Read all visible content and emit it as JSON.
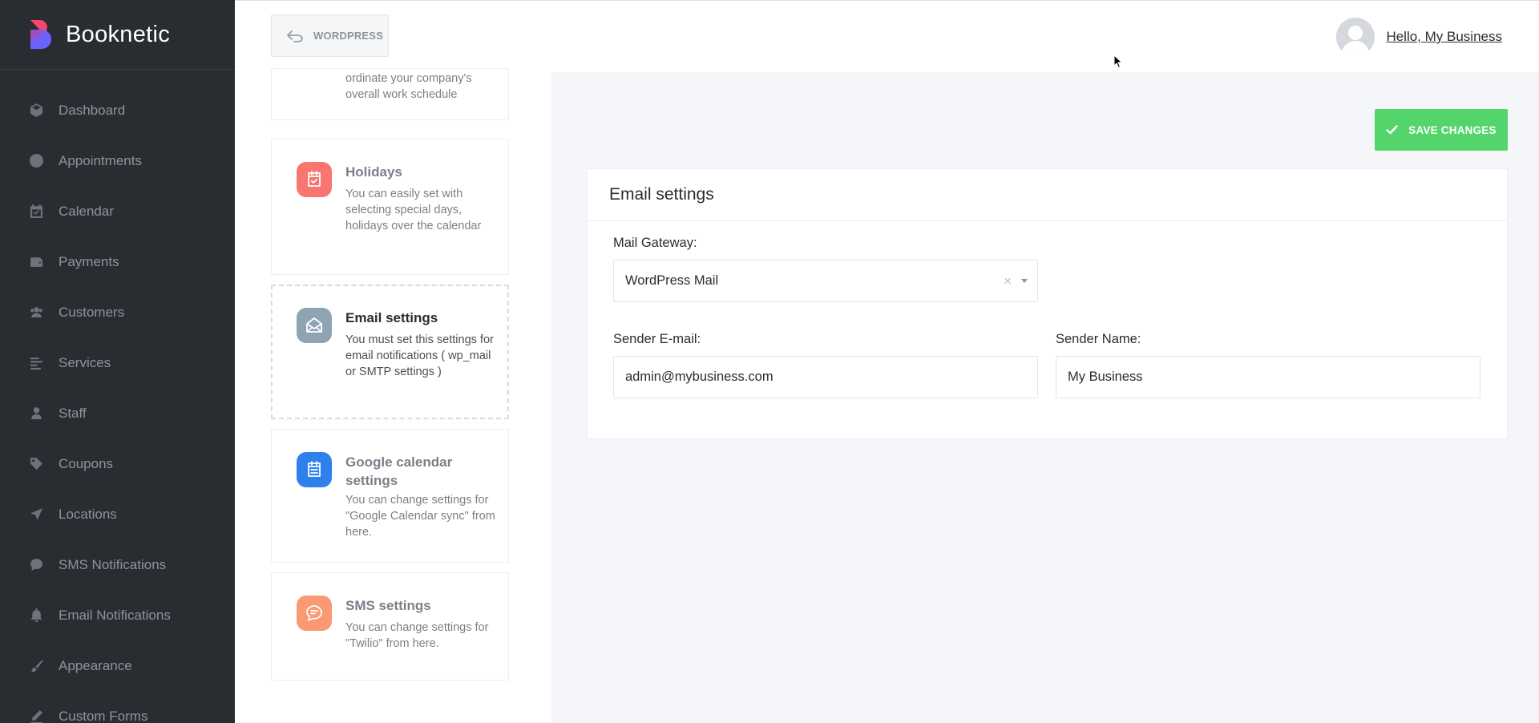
{
  "brand": {
    "name": "Booknetic"
  },
  "sidebar": {
    "items": [
      {
        "label": "Dashboard",
        "icon": "cube-icon"
      },
      {
        "label": "Appointments",
        "icon": "clock-icon"
      },
      {
        "label": "Calendar",
        "icon": "calendar-check-icon"
      },
      {
        "label": "Payments",
        "icon": "wallet-icon"
      },
      {
        "label": "Customers",
        "icon": "users-icon"
      },
      {
        "label": "Services",
        "icon": "list-icon"
      },
      {
        "label": "Staff",
        "icon": "user-icon"
      },
      {
        "label": "Coupons",
        "icon": "tag-icon"
      },
      {
        "label": "Locations",
        "icon": "location-arrow-icon"
      },
      {
        "label": "SMS Notifications",
        "icon": "comment-icon"
      },
      {
        "label": "Email Notifications",
        "icon": "bell-icon"
      },
      {
        "label": "Appearance",
        "icon": "brush-icon"
      },
      {
        "label": "Custom Forms",
        "icon": "pen-icon"
      }
    ]
  },
  "header": {
    "wordpress_label": "WORDPRESS",
    "user_greeting": "Hello, My Business"
  },
  "settings_cards": [
    {
      "title": "",
      "desc": "ordinate your company's overall work schedule",
      "icon": ""
    },
    {
      "title": "Holidays",
      "desc": "You can easily set with selecting special days, holidays over the calendar",
      "icon": "calendar-check-icon",
      "color": "#f9756f"
    },
    {
      "title": "Email settings",
      "desc": "You must set this settings for email notifications ( wp_mail or SMTP settings )",
      "icon": "envelope-open-icon",
      "color": "#8fa4b3"
    },
    {
      "title": "Google calendar settings",
      "desc": "You can change settings for \"Google Calendar sync\" from here.",
      "icon": "calendar-list-icon",
      "color": "#2f80ed"
    },
    {
      "title": "SMS settings",
      "desc": "You can change settings for \"Twilio\" from here.",
      "icon": "chat-bubble-icon",
      "color": "#fb9a72"
    }
  ],
  "main": {
    "save_label": "SAVE CHANGES",
    "panel_title": "Email settings",
    "mail_gateway": {
      "label": "Mail Gateway:",
      "value": "WordPress Mail",
      "clear": "×"
    },
    "sender_email": {
      "label": "Sender E-mail:",
      "value": "admin@mybusiness.com"
    },
    "sender_name": {
      "label": "Sender Name:",
      "value": "My Business"
    }
  },
  "colors": {
    "sidebar_bg": "#292d32",
    "accent_green": "#53d56c"
  }
}
